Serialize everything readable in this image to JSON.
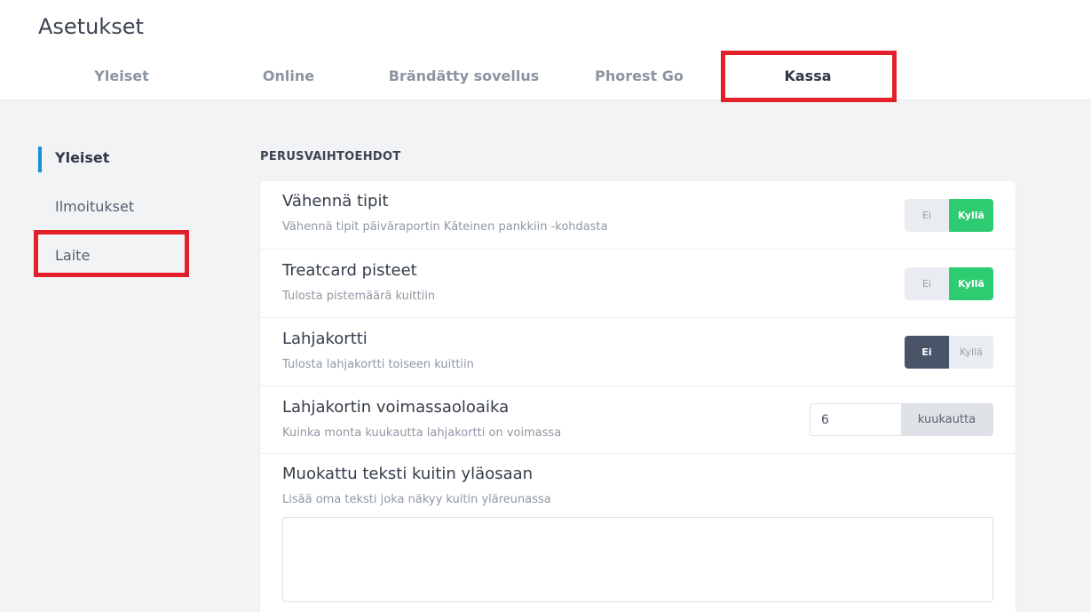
{
  "header": {
    "title": "Asetukset",
    "tabs": [
      {
        "label": "Yleiset"
      },
      {
        "label": "Online"
      },
      {
        "label": "Brändätty sovellus"
      },
      {
        "label": "Phorest Go"
      },
      {
        "label": "Kassa"
      }
    ]
  },
  "sidebar": {
    "items": [
      {
        "label": "Yleiset"
      },
      {
        "label": "Ilmoitukset"
      },
      {
        "label": "Laite"
      }
    ]
  },
  "main": {
    "section_label": "PERUSVAIHTOEHDOT",
    "settings": [
      {
        "title": "Vähennä tipit",
        "description": "Vähennä tipit päiväraportin Käteinen pankkiin -kohdasta",
        "no_label": "Ei",
        "yes_label": "Kyllä",
        "selected": "Kyllä"
      },
      {
        "title": "Treatcard pisteet",
        "description": "Tulosta pistemäärä kuittiin",
        "no_label": "Ei",
        "yes_label": "Kyllä",
        "selected": "Kyllä"
      },
      {
        "title": "Lahjakortti",
        "description": "Tulosta lahjakortti toiseen kuittiin",
        "no_label": "Ei",
        "yes_label": "Kyllä",
        "selected": "Ei"
      },
      {
        "title": "Lahjakortin voimassaoloaika",
        "description": "Kuinka monta kuukautta lahjakortti on voimassa",
        "value": "6",
        "unit": "kuukautta"
      },
      {
        "title": "Muokattu teksti kuitin yläosaan",
        "description": "Lisää oma teksti joka näkyy kuitin yläreunassa",
        "value": ""
      }
    ]
  },
  "colors": {
    "accent": "#1a8fd6",
    "toggle_on": "#2ecc71",
    "toggle_no_on": "#4a5468",
    "highlight": "#e3202a"
  }
}
